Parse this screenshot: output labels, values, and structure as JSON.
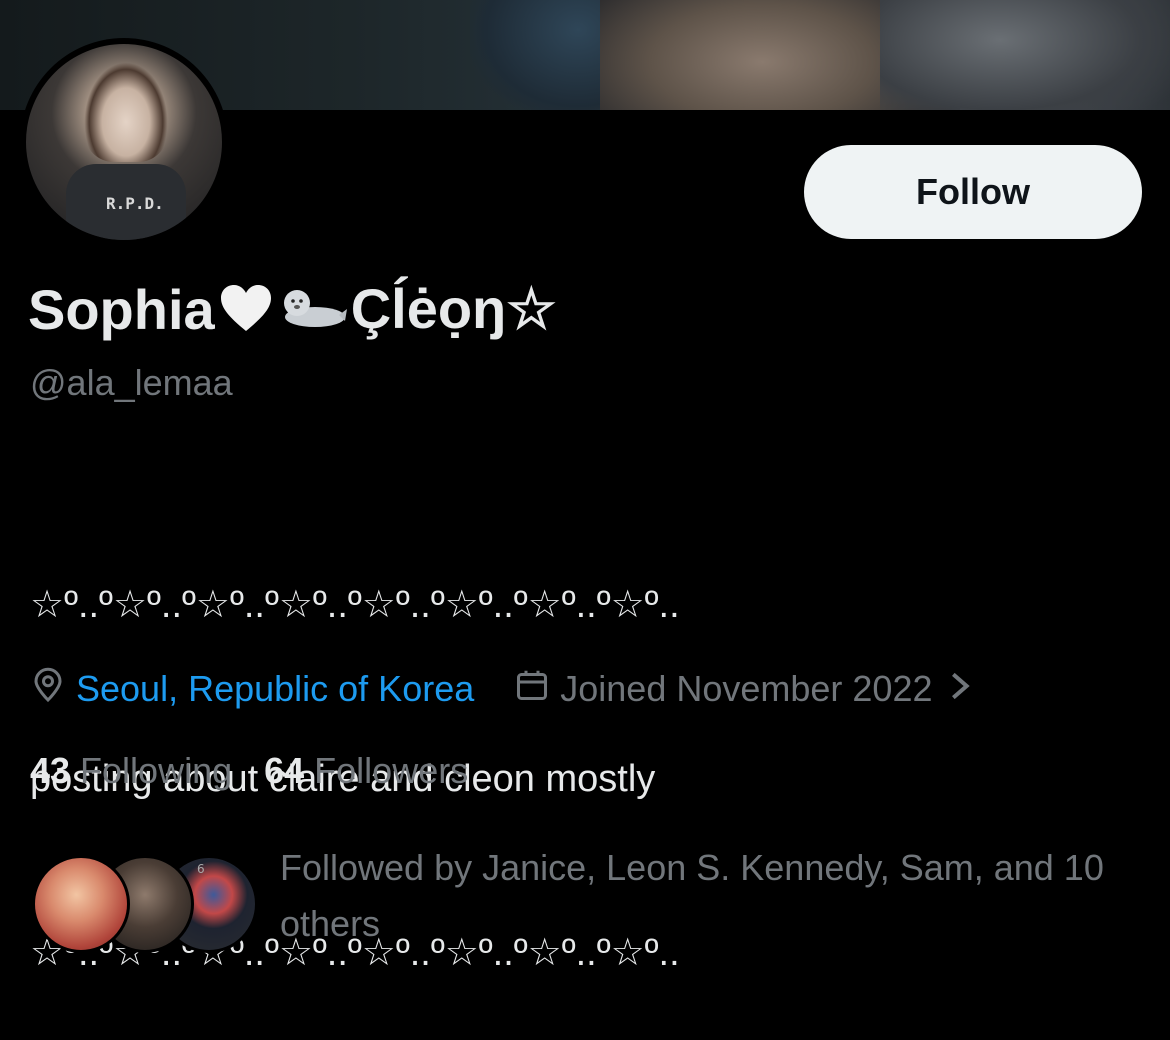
{
  "profile": {
    "display_name": "Sophia",
    "display_name_suffix": "Çĺėọŋ☆",
    "handle": "@ala_lemaa",
    "avatar_label": "R.P.D.",
    "bio_lines": [
      "☆º..º☆º..º☆º..º☆º..º☆º..º☆º..º☆º..º☆º..",
      "posting about claire and cleon mostly",
      "☆º..º☆º..º☆º..º☆º..º☆º..º☆º..º☆º..º☆º.."
    ],
    "location": "Seoul, Republic of Korea",
    "joined": "Joined November 2022",
    "following_count": "43",
    "following_label": "Following",
    "followers_count": "64",
    "followers_label": "Followers",
    "followed_by": "Followed by Janice, Leon S. Kennedy, Sam, and 10 others",
    "follower_avatar_badge": "6"
  },
  "actions": {
    "follow_label": "Follow"
  },
  "icons": {
    "location": "location-pin-icon",
    "joined": "calendar-icon",
    "chevron": "chevron-right-icon",
    "heart": "white-heart-icon",
    "seal": "seal-icon"
  },
  "colors": {
    "background": "#000000",
    "text_primary": "#e7e9ea",
    "text_secondary": "#71767b",
    "link": "#1d9bf0",
    "follow_button_bg": "#eff3f4",
    "follow_button_text": "#0f1419"
  }
}
